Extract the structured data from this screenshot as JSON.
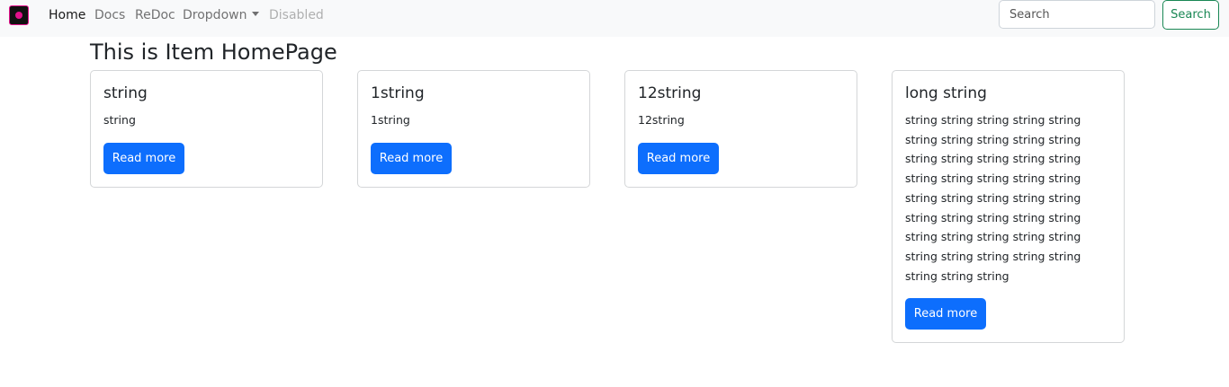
{
  "navbar": {
    "brand_name": "brand-logo",
    "links": [
      {
        "label": "Home"
      },
      {
        "label": "Docs"
      },
      {
        "label": "ReDoc"
      },
      {
        "label": "Dropdown"
      },
      {
        "label": "Disabled"
      }
    ],
    "search_placeholder": "Search",
    "search_button": "Search"
  },
  "page": {
    "title": "This is Item HomePage"
  },
  "cards": [
    {
      "title": "string",
      "text": "string",
      "button": "Read more"
    },
    {
      "title": "1string",
      "text": "1string",
      "button": "Read more"
    },
    {
      "title": "12string",
      "text": "12string",
      "button": "Read more"
    },
    {
      "title": "long string",
      "text": "string string string string string string string string string string string string string string string string string string string string string string string string string string string string string string string string string string string string string string string string string string string",
      "button": "Read more"
    }
  ],
  "colors": {
    "primary": "#0d6efd",
    "success": "#198754",
    "navbar_bg": "#f8f9fa"
  }
}
